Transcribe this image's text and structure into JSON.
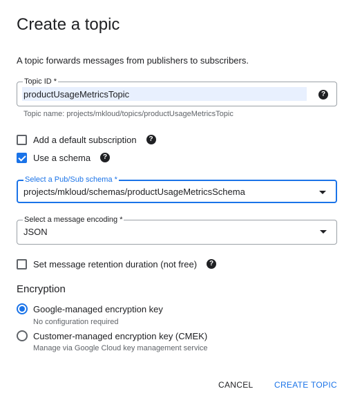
{
  "dialog": {
    "title": "Create a topic",
    "description": "A topic forwards messages from publishers to subscribers."
  },
  "topic_id": {
    "label": "Topic ID *",
    "value": "productUsageMetricsTopic",
    "hint": "Topic name: projects/mkloud/topics/productUsageMetricsTopic"
  },
  "options": {
    "default_subscription": {
      "label": "Add a default subscription",
      "checked": false
    },
    "use_schema": {
      "label": "Use a schema",
      "checked": true
    },
    "retention": {
      "label": "Set message retention duration (not free)",
      "checked": false
    }
  },
  "schema_select": {
    "label": "Select a Pub/Sub schema *",
    "value": "projects/mkloud/schemas/productUsageMetricsSchema"
  },
  "encoding_select": {
    "label": "Select a message encoding *",
    "value": "JSON"
  },
  "encryption": {
    "title": "Encryption",
    "google_managed": {
      "label": "Google-managed encryption key",
      "sub": "No configuration required",
      "selected": true
    },
    "customer_managed": {
      "label": "Customer-managed encryption key (CMEK)",
      "sub": "Manage via Google Cloud key management service",
      "selected": false
    }
  },
  "actions": {
    "cancel_label": "CANCEL",
    "create_label": "CREATE TOPIC"
  },
  "icons": {
    "help": "?"
  },
  "colors": {
    "accent": "#1a73e8",
    "text": "#202124",
    "secondary": "#5f6368"
  }
}
